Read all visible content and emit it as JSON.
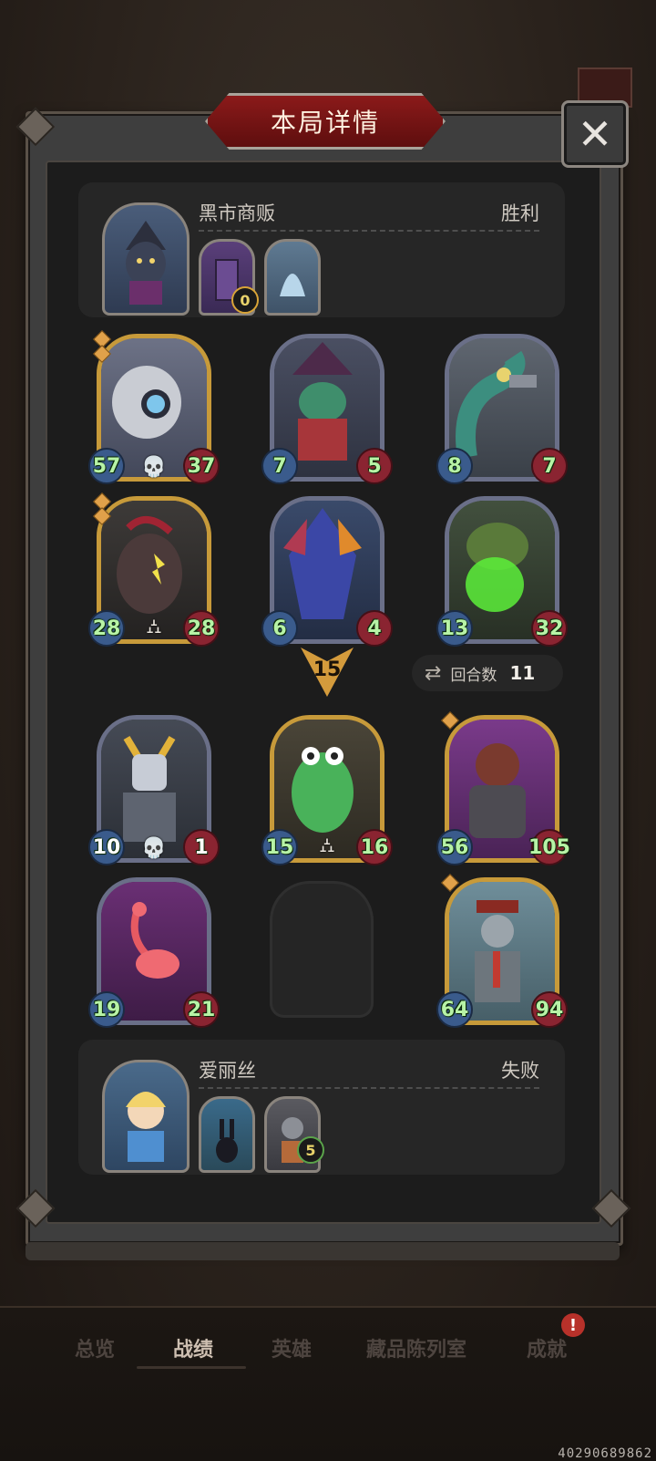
{
  "title": "本局详情",
  "close_glyph": "✕",
  "winner": {
    "name": "黑市商贩",
    "result": "胜利",
    "mini_badge": "0"
  },
  "loser": {
    "name": "爱丽丝",
    "result": "失败",
    "mini_badge": "5"
  },
  "top_board": [
    {
      "atk": "57",
      "hp": "37",
      "effect": "💀"
    },
    {
      "atk": "7",
      "hp": "5",
      "effect": ""
    },
    {
      "atk": "8",
      "hp": "7",
      "effect": ""
    },
    {
      "atk": "28",
      "hp": "28",
      "effect": "⛼"
    },
    {
      "atk": "6",
      "hp": "4",
      "effect": ""
    },
    {
      "atk": "13",
      "hp": "32",
      "effect": ""
    }
  ],
  "bottom_board": [
    {
      "atk": "10",
      "hp": "1",
      "effect": "💀"
    },
    {
      "atk": "15",
      "hp": "16",
      "effect": "⛼"
    },
    {
      "atk": "56",
      "hp": "105",
      "effect": ""
    },
    {
      "atk": "19",
      "hp": "21",
      "effect": ""
    },
    {
      "atk": "64",
      "hp": "94",
      "effect": ""
    }
  ],
  "swap_count": "15",
  "rounds": {
    "label": "回合数",
    "value": "11"
  },
  "nav": {
    "overview": "总览",
    "records": "战绩",
    "heroes": "英雄",
    "collection": "藏品陈列室",
    "achievements": "成就",
    "badge": "!"
  },
  "corner_code": "40290689862"
}
